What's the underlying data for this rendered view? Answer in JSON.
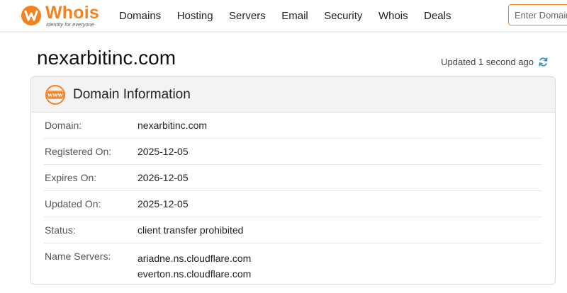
{
  "brand": {
    "name": "Whois",
    "tagline": "Identity for everyone",
    "accent": "#f58220"
  },
  "nav": {
    "items": [
      "Domains",
      "Hosting",
      "Servers",
      "Email",
      "Security",
      "Whois",
      "Deals"
    ]
  },
  "search": {
    "placeholder": "Enter Domain"
  },
  "page": {
    "title": "nexarbitinc.com",
    "updated": "Updated 1 second ago"
  },
  "card": {
    "title": "Domain Information",
    "icon": "www-icon",
    "rows": [
      {
        "label": "Domain:",
        "value": "nexarbitinc.com"
      },
      {
        "label": "Registered On:",
        "value": "2025-12-05"
      },
      {
        "label": "Expires On:",
        "value": "2026-12-05"
      },
      {
        "label": "Updated On:",
        "value": "2025-12-05"
      },
      {
        "label": "Status:",
        "value": "client transfer prohibited"
      },
      {
        "label": "Name Servers:",
        "values": [
          "ariadne.ns.cloudflare.com",
          "everton.ns.cloudflare.com"
        ]
      }
    ]
  }
}
